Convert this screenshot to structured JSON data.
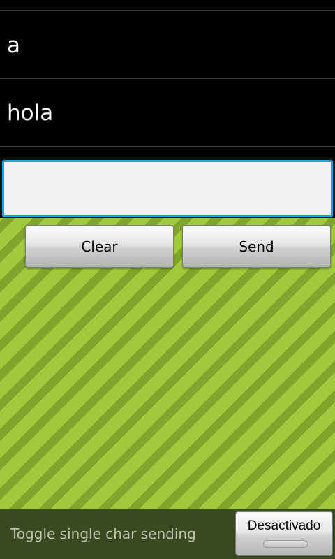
{
  "messages": [
    {
      "text": "a"
    },
    {
      "text": "hola"
    }
  ],
  "input": {
    "value": "",
    "placeholder": ""
  },
  "actions": {
    "clear_label": "Clear",
    "send_label": "Send"
  },
  "toggle": {
    "label": "Toggle single char sending",
    "state_label": "Desactivado",
    "enabled": false
  },
  "colors": {
    "input_focus_border": "#1ea3ee",
    "stripe_light": "#a2c83c",
    "stripe_dark": "#7fa52d",
    "bottom_bar": "#3c4a22"
  }
}
